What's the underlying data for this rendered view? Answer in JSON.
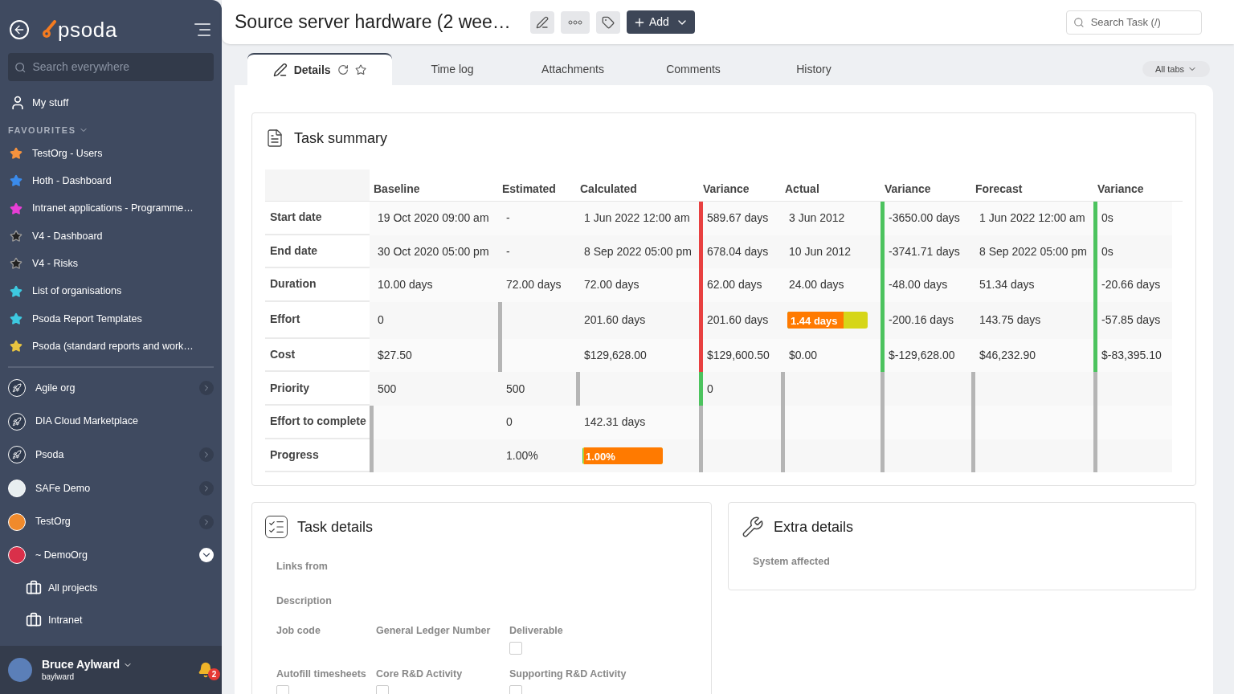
{
  "sidebar": {
    "logo": "psoda",
    "search": {
      "placeholder": "Search everywhere"
    },
    "my_stuff": "My stuff",
    "favourites_heading": "FAVOURITES",
    "favourites": [
      {
        "label": "TestOrg - Users",
        "color": "#f5923e"
      },
      {
        "label": "Hoth - Dashboard",
        "color": "#3b8beb"
      },
      {
        "label": "Intranet applications - Programme…",
        "color": "#e83fd6"
      },
      {
        "label": "V4 - Dashboard",
        "color": "#222222"
      },
      {
        "label": "V4 - Risks",
        "color": "#222222"
      },
      {
        "label": "List of organisations",
        "color": "#3ec9e0"
      },
      {
        "label": "Psoda Report Templates",
        "color": "#3ec9e0"
      },
      {
        "label": "Psoda (standard reports and work…",
        "color": "#e8c440"
      }
    ],
    "organisations": [
      {
        "label": "Agile org",
        "kind": "rocket",
        "color": "#2f3a4e",
        "expandable": true,
        "expanded": false
      },
      {
        "label": "DIA Cloud Marketplace",
        "kind": "rocket",
        "color": "#2f3a4e",
        "expandable": false
      },
      {
        "label": "Psoda",
        "kind": "rocket",
        "color": "#2f3a4e",
        "expandable": true,
        "expanded": false
      },
      {
        "label": "SAFe Demo",
        "kind": "logo",
        "color": "#e8eef0",
        "expandable": true,
        "expanded": false
      },
      {
        "label": "TestOrg",
        "kind": "logo",
        "color": "#f08a2c",
        "expandable": true,
        "expanded": false
      },
      {
        "label": "~ DemoOrg",
        "kind": "logo",
        "color": "#d9304a",
        "expandable": true,
        "expanded": true,
        "children": [
          {
            "label": "All projects"
          },
          {
            "label": "Intranet"
          }
        ]
      }
    ],
    "user": {
      "name": "Bruce Aylward",
      "username": "baylward",
      "notifications": "2"
    }
  },
  "header": {
    "title": "Source server hardware (2 wee…",
    "add_button": "Add",
    "search": {
      "placeholder": "Search Task (/)"
    }
  },
  "tabs": [
    {
      "label": "Details",
      "selected": true
    },
    {
      "label": "Time log",
      "selected": false
    },
    {
      "label": "Attachments",
      "selected": false
    },
    {
      "label": "Comments",
      "selected": false
    },
    {
      "label": "History",
      "selected": false
    }
  ],
  "all_tabs": "All tabs",
  "task_summary": {
    "title": "Task summary",
    "columns": [
      "Baseline",
      "Estimated",
      "Calculated",
      "Variance",
      "Actual",
      "Variance",
      "Forecast",
      "Variance"
    ],
    "rows": [
      {
        "label": "Start date",
        "cells": [
          {
            "kind": "text",
            "text": "19 Oct 2020 09:00 am"
          },
          {
            "kind": "text",
            "text": "-"
          },
          {
            "kind": "text",
            "text": "1 Jun 2022 12:00 am"
          },
          {
            "kind": "text",
            "text": "589.67 days",
            "color": "#e84040"
          },
          {
            "kind": "text",
            "text": "3 Jun 2012"
          },
          {
            "kind": "text",
            "text": "-3650.00 days",
            "color": "#4cc35e"
          },
          {
            "kind": "text",
            "text": "1 Jun 2022 12:00 am"
          },
          {
            "kind": "text",
            "text": "0s",
            "color": "#4cc35e"
          }
        ]
      },
      {
        "label": "End date",
        "cells": [
          {
            "kind": "text",
            "text": "30 Oct 2020 05:00 pm"
          },
          {
            "kind": "text",
            "text": "-"
          },
          {
            "kind": "text",
            "text": "8 Sep 2022 05:00 pm"
          },
          {
            "kind": "text",
            "text": "678.04 days",
            "color": "#e84040"
          },
          {
            "kind": "text",
            "text": "10 Jun 2012"
          },
          {
            "kind": "text",
            "text": "-3741.71 days",
            "color": "#4cc35e"
          },
          {
            "kind": "text",
            "text": "8 Sep 2022 05:00 pm"
          },
          {
            "kind": "text",
            "text": "0s",
            "color": "#4cc35e"
          }
        ]
      },
      {
        "label": "Duration",
        "cells": [
          {
            "kind": "text",
            "text": "10.00 days"
          },
          {
            "kind": "text",
            "text": "72.00 days"
          },
          {
            "kind": "text",
            "text": "72.00 days"
          },
          {
            "kind": "text",
            "text": "62.00 days",
            "color": "#e84040"
          },
          {
            "kind": "text",
            "text": "24.00 days"
          },
          {
            "kind": "text",
            "text": "-48.00 days",
            "color": "#4cc35e"
          },
          {
            "kind": "text",
            "text": "51.34 days"
          },
          {
            "kind": "text",
            "text": "-20.66 days",
            "color": "#4cc35e"
          }
        ]
      },
      {
        "label": "Effort",
        "cells": [
          {
            "kind": "text",
            "text": "0"
          },
          {
            "kind": "text",
            "color": "#b5b5b5"
          },
          {
            "kind": "text",
            "text": "201.60 days"
          },
          {
            "kind": "text",
            "text": "201.60 days",
            "color": "#e84040"
          },
          {
            "kind": "bar",
            "text": "1.44 days",
            "level": 0.7
          },
          {
            "kind": "text",
            "text": "-200.16 days",
            "color": "#4cc35e"
          },
          {
            "kind": "text",
            "text": "143.75 days"
          },
          {
            "kind": "text",
            "text": "-57.85 days",
            "color": "#4cc35e"
          }
        ]
      },
      {
        "label": "Cost",
        "cells": [
          {
            "kind": "text",
            "text": "$27.50"
          },
          {
            "kind": "text",
            "color": "#b5b5b5"
          },
          {
            "kind": "text",
            "text": "$129,628.00"
          },
          {
            "kind": "text",
            "text": "$129,600.50",
            "color": "#e84040"
          },
          {
            "kind": "text",
            "text": "$0.00"
          },
          {
            "kind": "text",
            "text": "$-129,628.00",
            "color": "#4cc35e"
          },
          {
            "kind": "text",
            "text": "$46,232.90"
          },
          {
            "kind": "text",
            "text": "$-83,395.10",
            "color": "#4cc35e"
          }
        ]
      },
      {
        "label": "Priority",
        "cells": [
          {
            "kind": "text",
            "text": "500"
          },
          {
            "kind": "text",
            "text": "500"
          },
          {
            "kind": "text",
            "color": "#b5b5b5"
          },
          {
            "kind": "text",
            "text": "0",
            "color": "#4cc35e"
          },
          {
            "kind": "text",
            "color": "#b5b5b5"
          },
          {
            "kind": "text",
            "color": "#b5b5b5"
          },
          {
            "kind": "text",
            "color": "#b5b5b5"
          },
          {
            "kind": "text",
            "color": "#b5b5b5"
          }
        ]
      },
      {
        "label": "Effort to complete",
        "cells": [
          {
            "kind": "text",
            "color": "#b5b5b5"
          },
          {
            "kind": "text",
            "text": "0"
          },
          {
            "kind": "text",
            "text": "142.31 days"
          },
          {
            "kind": "text",
            "color": "#b5b5b5"
          },
          {
            "kind": "text",
            "color": "#b5b5b5"
          },
          {
            "kind": "text",
            "color": "#b5b5b5"
          },
          {
            "kind": "text",
            "color": "#b5b5b5"
          },
          {
            "kind": "text",
            "color": "#b5b5b5"
          }
        ]
      },
      {
        "label": "Progress",
        "cells": [
          {
            "kind": "text",
            "color": "#b5b5b5"
          },
          {
            "kind": "text",
            "text": "1.00%"
          },
          {
            "kind": "bar",
            "text": "1.00%",
            "level": 0.01
          },
          {
            "kind": "text",
            "color": "#b5b5b5"
          },
          {
            "kind": "text",
            "color": "#b5b5b5"
          },
          {
            "kind": "text",
            "color": "#b5b5b5"
          },
          {
            "kind": "text",
            "color": "#b5b5b5"
          },
          {
            "kind": "text",
            "color": "#b5b5b5"
          }
        ]
      }
    ]
  },
  "task_details": {
    "title": "Task details",
    "fields": [
      {
        "label": "Links from"
      },
      {
        "label": "Description"
      }
    ],
    "rows": [
      [
        {
          "label": "Job code",
          "kind": "text"
        },
        {
          "label": "General Ledger Number",
          "kind": "text"
        },
        {
          "label": "Deliverable",
          "kind": "checkbox",
          "checked": false
        }
      ],
      [
        {
          "label": "Autofill timesheets",
          "kind": "checkbox",
          "checked": false
        },
        {
          "label": "Core R&D Activity",
          "kind": "checkbox",
          "checked": false
        },
        {
          "label": "Supporting R&D Activity",
          "kind": "checkbox",
          "checked": false
        }
      ]
    ]
  },
  "extra_details": {
    "title": "Extra details",
    "fields": [
      {
        "label": "System affected"
      }
    ]
  }
}
